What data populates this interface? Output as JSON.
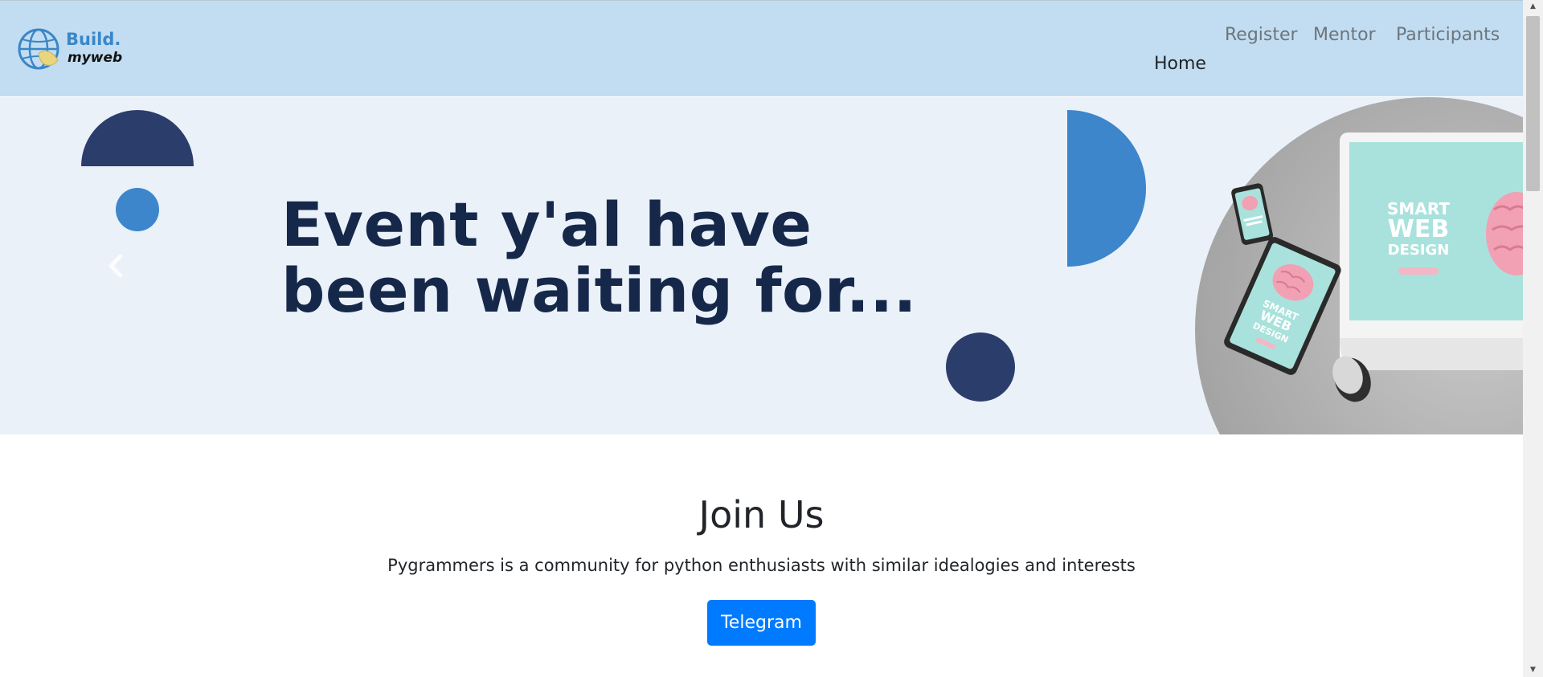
{
  "brand": {
    "name_top": "Build.",
    "name_bottom": "myweb",
    "icon": "globe-hand-icon"
  },
  "nav": {
    "items": [
      {
        "label": "Register"
      },
      {
        "label": "Mentor"
      },
      {
        "label": "Participants"
      },
      {
        "label": "Home"
      }
    ]
  },
  "hero": {
    "title": "Event y'al have been waiting for...",
    "prev_icon": "chevron-left-icon",
    "image": {
      "screen_title_large": "SMART\nWEB\nDESIGN",
      "screen_title_tablet": "SMART\nWEB\nDESIGN"
    }
  },
  "join": {
    "title": "Join Us",
    "description": "Pygrammers is a community for python enthusiasts with similar idealogies and interests",
    "button_label": "Telegram"
  },
  "colors": {
    "navbar_bg": "#c2ddf1",
    "hero_bg": "#eaf1f9",
    "navy": "#2b3d6b",
    "blue": "#3d86cc",
    "title": "#16284a",
    "button": "#007bff"
  }
}
